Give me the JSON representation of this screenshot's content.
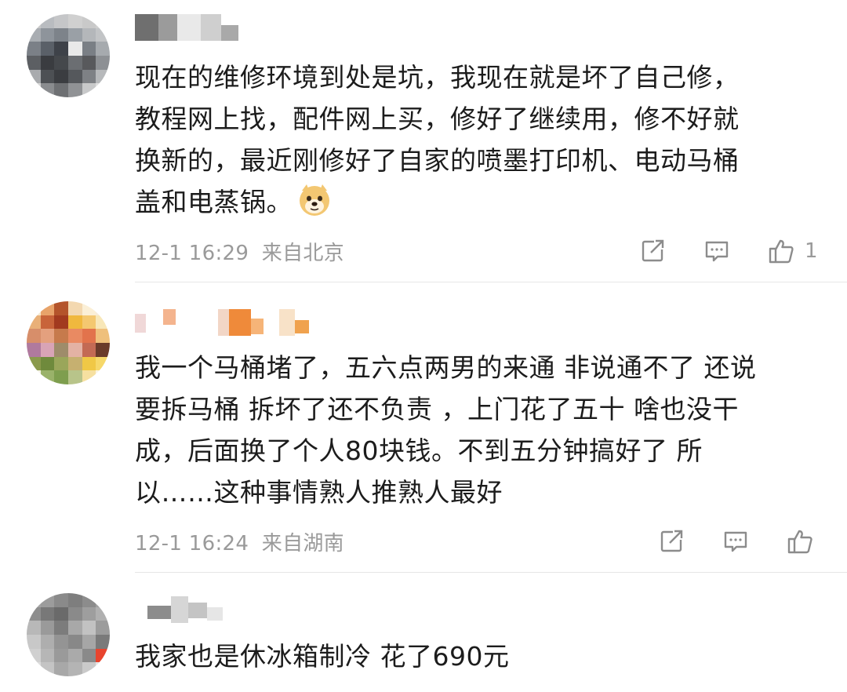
{
  "comments": [
    {
      "text": "现在的维修环境到处是坑，我现在就是坏了自己修，\n教程网上找，配件网上买，修好了继续用，修不好就\n换新的，最近刚修好了自家的喷墨打印机、电动马桶\n盖和电蒸锅。",
      "emoji": "doge",
      "time": "12-1 16:29",
      "location": "来自北京",
      "like_count": "1"
    },
    {
      "text": "我一个马桶堵了，五六点两男的来通 非说通不了 还说\n要拆马桶 拆坏了还不负责 ，上门花了五十 啥也没干\n成，后面换了个人80块钱。不到五分钟搞好了 所\n以……这种事情熟人推熟人最好",
      "time": "12-1 16:24",
      "location": "来自湖南"
    },
    {
      "text": "我家也是休冰箱制冷 花了690元"
    }
  ],
  "icons": {
    "share": "share-icon",
    "comment": "comment-icon",
    "like": "thumbs-up-icon",
    "emoji": "doge-emoji-icon"
  },
  "colors": {
    "text": "#1c1c1c",
    "meta": "#9a9a9a",
    "divider": "#e6e6e6",
    "icon": "#8c8c8c"
  }
}
